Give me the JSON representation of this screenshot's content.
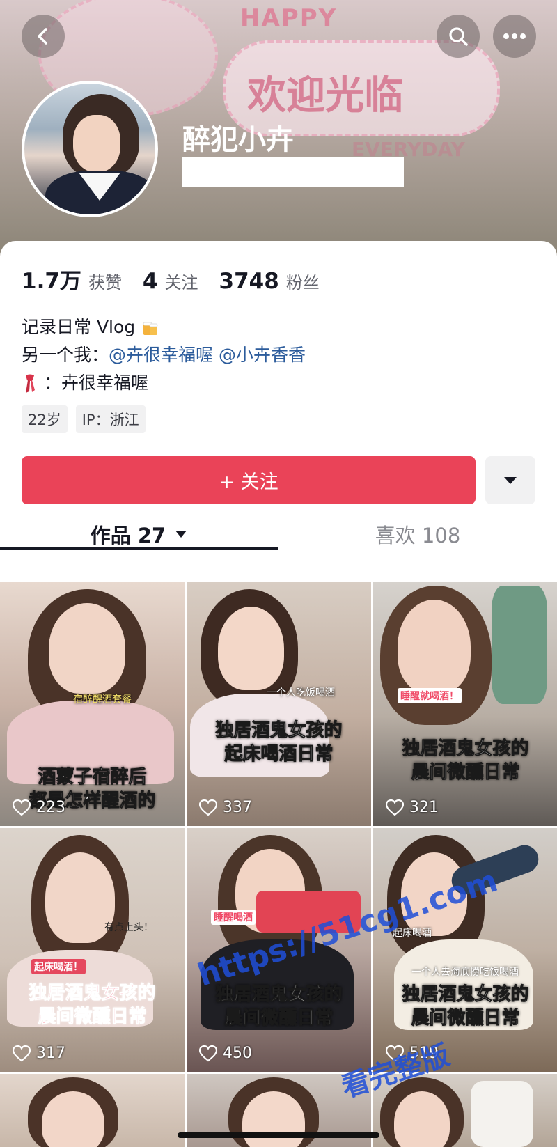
{
  "header": {
    "nickname": "醉犯小卉",
    "banner_text": {
      "happy": "HAPPY",
      "welcome": "欢迎光临",
      "everyday": "EVERYDAY"
    }
  },
  "stats": [
    {
      "value": "1.7万",
      "label": "获赞"
    },
    {
      "value": "4",
      "label": "关注"
    },
    {
      "value": "3748",
      "label": "粉丝"
    }
  ],
  "bio": {
    "line1": "记录日常 Vlog",
    "line2_prefix": "另一个我：",
    "mention1": "@卉很幸福喔",
    "mention2": "@小卉香香",
    "line3": "：卉很幸福喔"
  },
  "tags": [
    "22岁",
    "IP：浙江"
  ],
  "follow_button": {
    "label": "+ 关注"
  },
  "tabs": {
    "works": "作品 27",
    "likes": "喜欢 108"
  },
  "videos": [
    {
      "caption": "酒蒙子宿醉后\n都是怎样醒酒的",
      "sub": "宿醉醒酒套餐",
      "likes": "223"
    },
    {
      "caption": "独居酒鬼女孩的\n起床喝酒日常",
      "sub": "一个人吃饭喝酒",
      "likes": "337"
    },
    {
      "caption": "独居酒鬼女孩的\n晨间微醺日常",
      "sub": "睡醒就喝酒！",
      "likes": "321"
    },
    {
      "caption": "独居酒鬼女孩的\n晨间微醺日常",
      "sub": "起床喝酒！",
      "sub2": "有点上头！",
      "likes": "317"
    },
    {
      "caption": "独居酒鬼女孩的\n晨间微醺日常",
      "sub": "睡醒喝酒",
      "likes": "450"
    },
    {
      "caption": "独居酒鬼女孩的\n晨间微醺日常",
      "sub": "起床喝酒",
      "sub2": "一个人去海底捞吃饭喝酒",
      "likes": "519"
    }
  ],
  "watermark": {
    "line1": "https://51cg1.com",
    "line2": "看完整版"
  },
  "colors": {
    "accent": "#ea4358",
    "mention": "#2b5b9b",
    "text": "#161823",
    "secondary": "#60626b"
  }
}
